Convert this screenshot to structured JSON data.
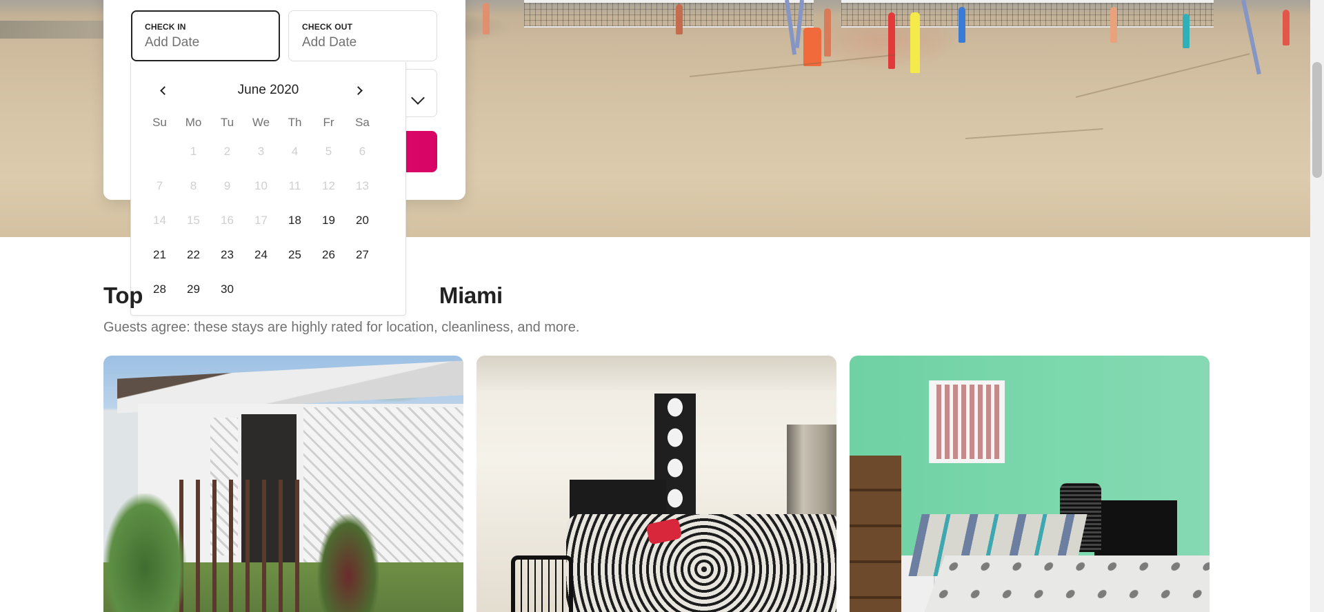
{
  "search": {
    "check_in": {
      "label": "CHECK IN",
      "placeholder": "Add Date"
    },
    "check_out": {
      "label": "CHECK OUT",
      "placeholder": "Add Date"
    }
  },
  "calendar": {
    "month_title": "June 2020",
    "weekdays": [
      "Su",
      "Mo",
      "Tu",
      "We",
      "Th",
      "Fr",
      "Sa"
    ],
    "weeks": [
      [
        "",
        "1",
        "2",
        "3",
        "4",
        "5",
        "6"
      ],
      [
        "7",
        "8",
        "9",
        "10",
        "11",
        "12",
        "13"
      ],
      [
        "14",
        "15",
        "16",
        "17",
        "18",
        "19",
        "20"
      ],
      [
        "21",
        "22",
        "23",
        "24",
        "25",
        "26",
        "27"
      ],
      [
        "28",
        "29",
        "30",
        "",
        "",
        "",
        ""
      ]
    ],
    "first_available_day": 18
  },
  "section": {
    "title_left": "Top",
    "title_right": "Miami",
    "subtitle": "Guests agree: these stays are highly rated for location, cleanliness, and more."
  },
  "colors": {
    "search_button": "#e00b6b",
    "text_primary": "#222222",
    "text_muted": "#717171",
    "day_disabled": "#cfcfcf"
  },
  "icons": [
    "chevron-left-icon",
    "chevron-right-icon",
    "chevron-down-icon"
  ]
}
